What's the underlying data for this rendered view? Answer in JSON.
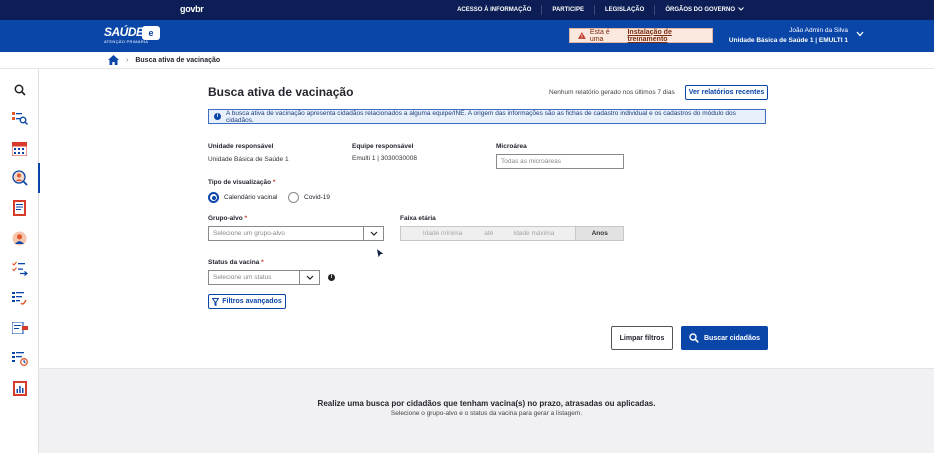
{
  "govbar": {
    "logo": "govbr",
    "links": [
      "ACESSO À INFORMAÇÃO",
      "PARTICIPE",
      "LEGISLAÇÃO",
      "ÓRGÃOS DO GOVERNO"
    ]
  },
  "header": {
    "logo_main": "SAÚDE",
    "logo_sub": "ATENÇÃO PRIMÁRIA",
    "logo_badge": "e",
    "training_prefix": "Esta é uma",
    "training_link": "Instalação de treinamento",
    "user_name": "João Admin da Silva",
    "user_unit": "Unidade Básica de Saúde 1 | EMULTI 1"
  },
  "breadcrumb": {
    "current": "Busca ativa de vacinação"
  },
  "sidebar": {
    "icons": [
      "search-icon",
      "list-search-icon",
      "calendar-icon",
      "person-search-icon",
      "document-icon",
      "user-icon",
      "checklist-icon",
      "tasks-icon",
      "card-icon",
      "schedule-list-icon",
      "report-chart-icon"
    ]
  },
  "main": {
    "title": "Busca ativa de vacinação",
    "report_status": "Nenhum relatório gerado nos últimos 7 dias",
    "reports_button": "Ver relatórios recentes",
    "info_text": "A busca ativa de vacinação apresenta cidadãos relacionados a alguma equipe/INE. A origem das informações são as fichas de cadastro individual e os cadastros do módulo dos cidadãos.",
    "unit_label": "Unidade responsável",
    "unit_value": "Unidade Básica de Saúde 1",
    "team_label": "Equipe responsável",
    "team_value": "Emulti 1 | 3030030008",
    "microarea_label": "Microárea",
    "microarea_placeholder": "Todas as microáreas",
    "view_label": "Tipo de visualização",
    "view_options": [
      "Calendário vacinal",
      "Covid-19"
    ],
    "view_selected": "Calendário vacinal",
    "group_label": "Grupo-alvo",
    "group_placeholder": "Selecione um grupo-alvo",
    "age_label": "Faixa etária",
    "age_min_placeholder": "Idade mínima",
    "age_sep": "até",
    "age_max_placeholder": "Idade máxima",
    "age_unit": "Anos",
    "status_label": "Status da vacina",
    "status_placeholder": "Selecione um status",
    "required_mark": "*",
    "advanced_filters": "Filtros avançados",
    "clear_button": "Limpar filtros",
    "search_button": "Buscar cidadãos"
  },
  "empty_state": {
    "title": "Realize uma busca por cidadãos que tenham vacina(s) no prazo, atrasadas ou aplicadas.",
    "subtitle": "Selecione o grupo-alvo e o status da vacina para gerar a listagem."
  },
  "colors": {
    "primary": "#0a45a8",
    "govbar": "#0c1e55",
    "required": "#c0392b"
  }
}
